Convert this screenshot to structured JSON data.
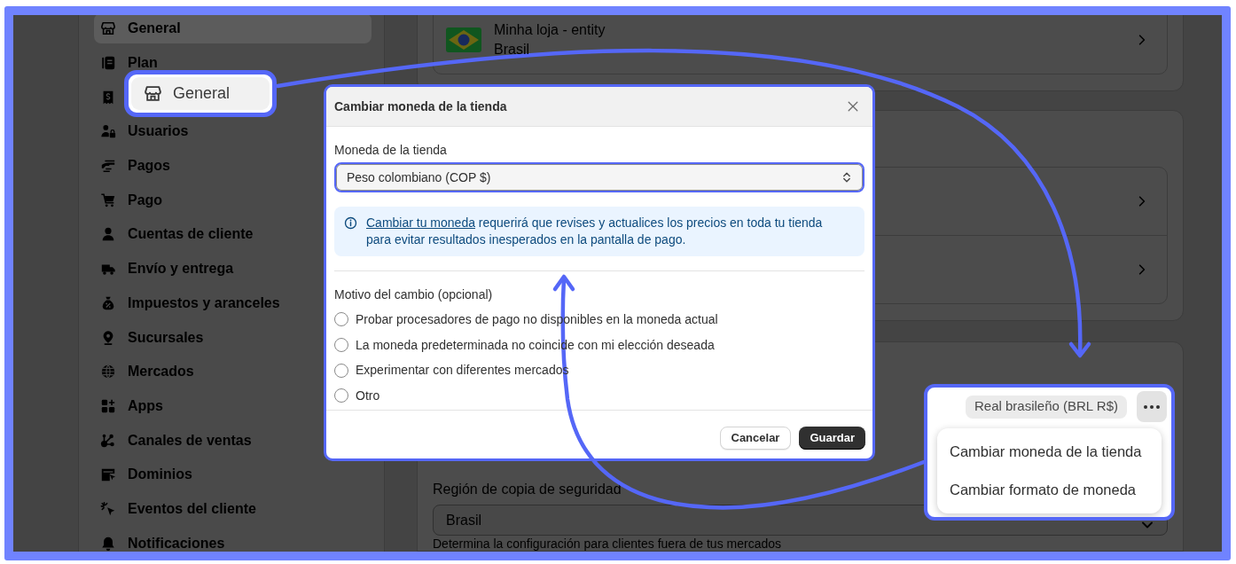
{
  "sidebar": {
    "items": [
      {
        "label": "General",
        "selected": true
      },
      {
        "label": "Plan",
        "selected": false
      },
      {
        "selected": false
      },
      {
        "label": "Usuarios",
        "selected": false
      },
      {
        "label": "Pagos",
        "selected": false
      },
      {
        "label": "Pago",
        "selected": false
      },
      {
        "label": "Cuentas de cliente",
        "selected": false
      },
      {
        "label": "Envío y entrega",
        "selected": false
      },
      {
        "label": "Impuestos y aranceles",
        "selected": false
      },
      {
        "label": "Sucursales",
        "selected": false
      },
      {
        "label": "Mercados",
        "selected": false
      },
      {
        "label": "Apps",
        "selected": false
      },
      {
        "label": "Canales de ventas",
        "selected": false
      },
      {
        "label": "Dominios",
        "selected": false
      },
      {
        "label": "Eventos del cliente",
        "selected": false
      },
      {
        "label": "Notificaciones",
        "selected": false
      }
    ]
  },
  "store_card": {
    "name": "Minha loja - entity",
    "country": "Brasil"
  },
  "backup_region": {
    "label": "Región de copia de seguridad",
    "value": "Brasil",
    "help": "Determina la configuración para clientes fuera de tus mercados"
  },
  "general_callout": {
    "label": "General"
  },
  "modal": {
    "title": "Cambiar moneda de la tienda",
    "currency_field": {
      "label": "Moneda de la tienda",
      "value": "Peso colombiano (COP $)"
    },
    "notice": {
      "link": "Cambiar tu moneda",
      "text": "requerirá que revises y actualices los precios en toda tu tienda para evitar resultados inesperados en la pantalla de pago."
    },
    "reason": {
      "label": "Motivo del cambio (opcional)",
      "options": [
        {
          "label": "Probar procesadores de pago no disponibles en la moneda actual",
          "selected": false
        },
        {
          "label": "La moneda predeterminada no coincide con mi elección deseada",
          "selected": false
        },
        {
          "label": "Experimentar con diferentes mercados",
          "selected": false
        },
        {
          "label": "Otro",
          "selected": false
        }
      ]
    },
    "buttons": [
      {
        "label": "Cancelar",
        "kind": "secondary"
      },
      {
        "label": "Guardar",
        "kind": "primary"
      }
    ]
  },
  "currency_callout": {
    "badge": "Real brasileño (BRL R$)",
    "menu": [
      {
        "label": "Cambiar moneda de la tienda"
      },
      {
        "label": "Cambiar formato de moneda"
      }
    ]
  }
}
